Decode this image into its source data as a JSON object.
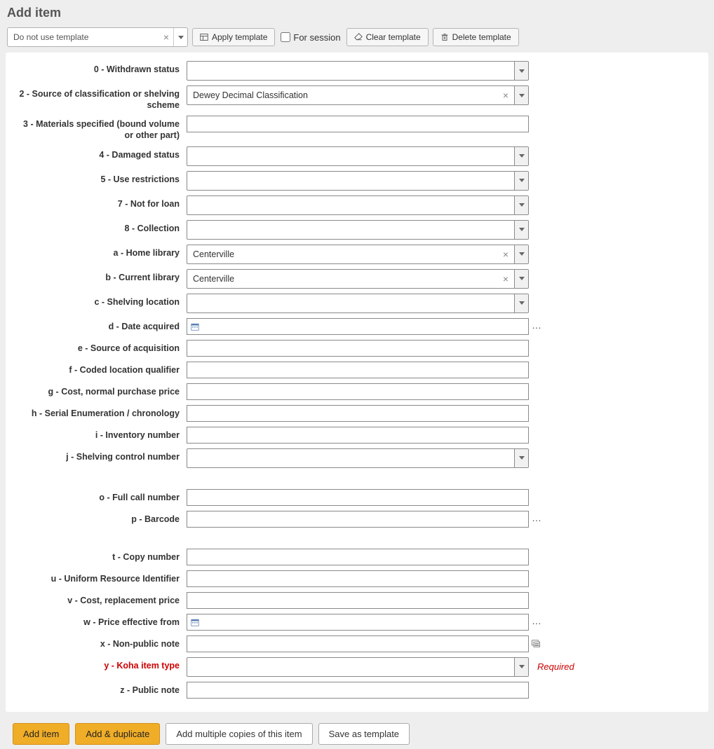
{
  "title": "Add item",
  "template_selector": {
    "value": "Do not use template"
  },
  "toolbar": {
    "apply": "Apply template",
    "for_session": "For session",
    "clear": "Clear template",
    "delete": "Delete template"
  },
  "fields": {
    "f0": {
      "label": "0 - Withdrawn status",
      "type": "select",
      "value": ""
    },
    "f2": {
      "label": "2 - Source of classification or shelving scheme",
      "type": "select",
      "value": "Dewey Decimal Classification",
      "clearable": true
    },
    "f3": {
      "label": "3 - Materials specified (bound volume or other part)",
      "type": "text",
      "value": ""
    },
    "f4": {
      "label": "4 - Damaged status",
      "type": "select",
      "value": ""
    },
    "f5": {
      "label": "5 - Use restrictions",
      "type": "select",
      "value": ""
    },
    "f7": {
      "label": "7 - Not for loan",
      "type": "select",
      "value": ""
    },
    "f8": {
      "label": "8 - Collection",
      "type": "select",
      "value": ""
    },
    "fa": {
      "label": "a - Home library",
      "type": "select",
      "value": "Centerville",
      "clearable": true
    },
    "fb": {
      "label": "b - Current library",
      "type": "select",
      "value": "Centerville",
      "clearable": true
    },
    "fc": {
      "label": "c - Shelving location",
      "type": "select",
      "value": ""
    },
    "fd": {
      "label": "d - Date acquired",
      "type": "date",
      "value": ""
    },
    "fe": {
      "label": "e - Source of acquisition",
      "type": "text",
      "value": ""
    },
    "ff": {
      "label": "f - Coded location qualifier",
      "type": "text",
      "value": ""
    },
    "fg": {
      "label": "g - Cost, normal purchase price",
      "type": "text",
      "value": ""
    },
    "fh": {
      "label": "h - Serial Enumeration / chronology",
      "type": "text",
      "value": ""
    },
    "fi": {
      "label": "i - Inventory number",
      "type": "text",
      "value": ""
    },
    "fj": {
      "label": "j - Shelving control number",
      "type": "select",
      "value": ""
    },
    "fo": {
      "label": "o - Full call number",
      "type": "text",
      "value": ""
    },
    "fp": {
      "label": "p - Barcode",
      "type": "text",
      "value": ""
    },
    "ft": {
      "label": "t - Copy number",
      "type": "text",
      "value": ""
    },
    "fu": {
      "label": "u - Uniform Resource Identifier",
      "type": "text",
      "value": ""
    },
    "fv": {
      "label": "v - Cost, replacement price",
      "type": "text",
      "value": ""
    },
    "fw": {
      "label": "w - Price effective from",
      "type": "date",
      "value": ""
    },
    "fx": {
      "label": "x - Non-public note",
      "type": "text",
      "value": ""
    },
    "fy": {
      "label": "y - Koha item type",
      "type": "select",
      "value": "",
      "required": true
    },
    "fz": {
      "label": "z - Public note",
      "type": "text",
      "value": ""
    }
  },
  "required_text": "Required",
  "footer": {
    "add": "Add item",
    "add_dup": "Add & duplicate",
    "add_multi": "Add multiple copies of this item",
    "save_tpl": "Save as template"
  }
}
